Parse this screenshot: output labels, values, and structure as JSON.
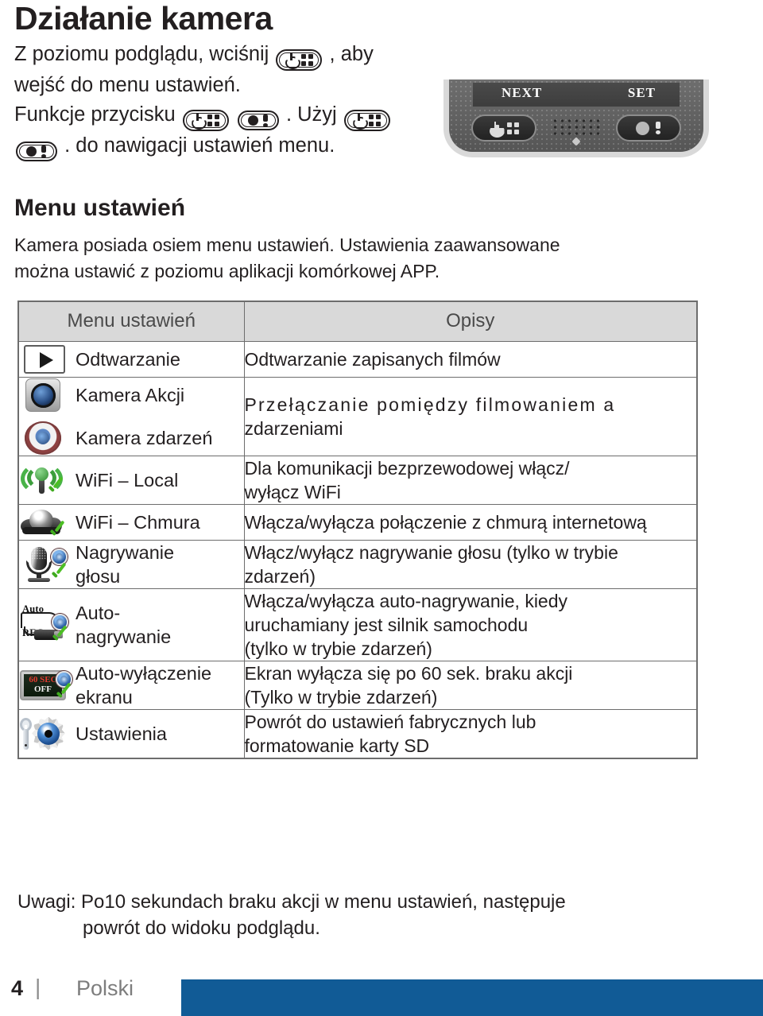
{
  "heading": "Działanie kamera",
  "intro": {
    "line1_a": "Z poziomu podglądu, wciśnij",
    "line1_b": ",  aby",
    "line2": "wejść do menu ustawień.",
    "line3_a": "Funkcje przycisku",
    "line3_b": ". Użyj",
    "line4": ". do nawigacji ustawień menu."
  },
  "camera": {
    "next_label": "NEXT",
    "set_label": "SET"
  },
  "section2": {
    "heading": "Menu ustawień",
    "para_line1": "Kamera posiada osiem menu ustawień. Ustawienia zaawansowane",
    "para_line2": "można ustawić z poziomu aplikacji komórkowej APP."
  },
  "table": {
    "header": {
      "menu": "Menu ustawień",
      "desc": "Opisy"
    },
    "rows": [
      {
        "items": [
          {
            "icon": "play-icon",
            "label": "Odtwarzanie"
          }
        ],
        "desc": [
          "Odtwarzanie zapisanych filmów"
        ],
        "spaced": false
      },
      {
        "items": [
          {
            "icon": "camera-lens-icon",
            "label": "Kamera Akcji"
          },
          {
            "icon": "steering-wheel-icon",
            "label": "Kamera zdarzeń"
          }
        ],
        "desc": [
          "Przełączanie pomiędzy filmowaniem a",
          "zdarzeniami"
        ],
        "spaced": true
      },
      {
        "items": [
          {
            "icon": "wifi-antenna-icon",
            "label": "WiFi – Local"
          }
        ],
        "desc": [
          "Dla komunikacji bezprzewodowej włącz/",
          "wyłącz WiFi"
        ],
        "spaced": false
      },
      {
        "items": [
          {
            "icon": "cloud-icon",
            "label": "WiFi – Chmura"
          }
        ],
        "desc": [
          "Włącza/wyłącza połączenie z chmurą internetową"
        ],
        "spaced": false
      },
      {
        "items": [
          {
            "icon": "microphone-icon",
            "label": "Nagrywanie\ngłosu"
          }
        ],
        "desc": [
          "Włącz/wyłącz nagrywanie głosu (tylko w trybie",
          "zdarzeń)"
        ],
        "spaced": false
      },
      {
        "items": [
          {
            "icon": "auto-rec-icon",
            "label": "Auto-\nnagrywanie",
            "badge_text": "Auto REC"
          }
        ],
        "desc": [
          "Włącza/wyłącza auto-nagrywanie, kiedy",
          "uruchamiany jest silnik samochodu",
          "(tylko w trybie zdarzeń)"
        ],
        "spaced": false
      },
      {
        "items": [
          {
            "icon": "screen-off-60sec-icon",
            "label": "Auto-wyłączenie\nekranu",
            "badge_line1": "60 SEC",
            "badge_line2": "OFF"
          }
        ],
        "desc": [
          "Ekran wyłącza się po 60 sek. braku akcji",
          "(Tylko w trybie zdarzeń)"
        ],
        "spaced": false
      },
      {
        "items": [
          {
            "icon": "settings-gear-icon",
            "label": "Ustawienia"
          }
        ],
        "desc": [
          "Powrót do ustawień fabrycznych lub",
          "formatowanie karty SD"
        ],
        "spaced": false
      }
    ]
  },
  "note": {
    "line1": "Uwagi: Po10 sekundach braku akcji w menu ustawień, następuje",
    "line2": "powrót do widoku podglądu."
  },
  "footer": {
    "page_number": "4",
    "separator": "|",
    "language": "Polski",
    "bar_color": "#115b96"
  }
}
